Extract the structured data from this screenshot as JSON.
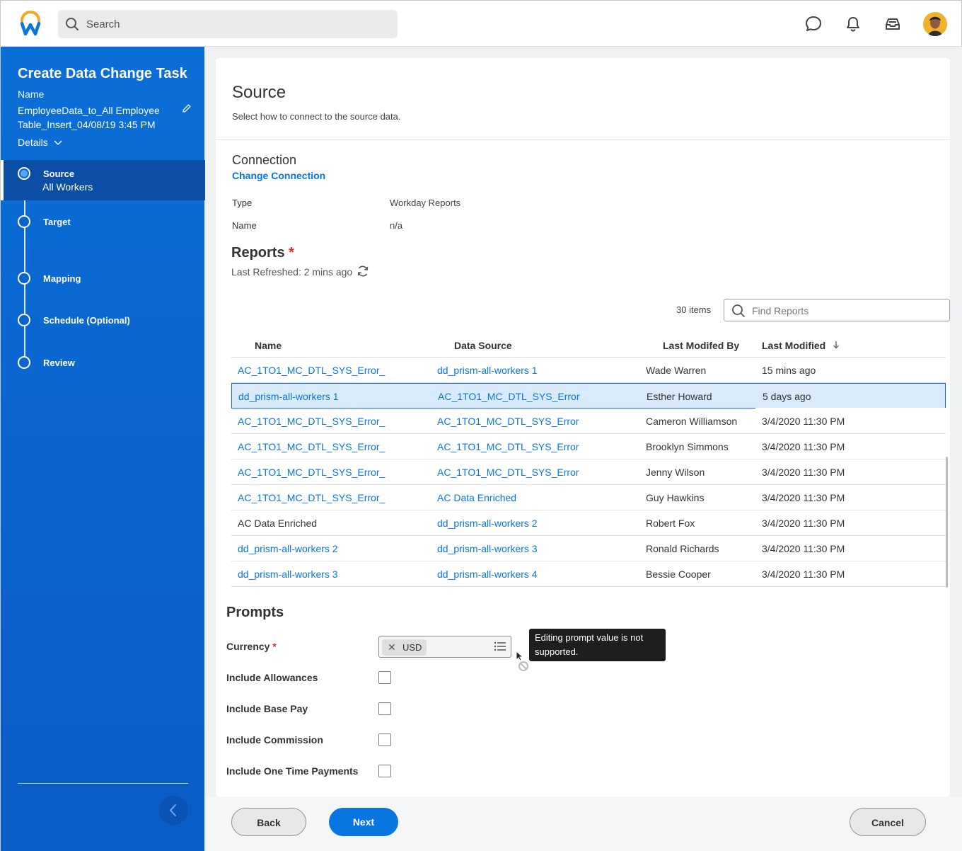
{
  "topbar": {
    "search_placeholder": "Search",
    "icons": [
      "chat-icon",
      "bell-icon",
      "inbox-icon"
    ]
  },
  "sidebar": {
    "title": "Create Data Change Task",
    "name_label": "Name",
    "name_value": "EmployeeData_to_All Employee Table_Insert_04/08/19 3:45 PM",
    "details_label": "Details",
    "steps": [
      {
        "label": "Source",
        "sub": "All Workers",
        "active": true
      },
      {
        "label": "Target",
        "sub": ""
      },
      {
        "label": "Mapping",
        "sub": ""
      },
      {
        "label": "Schedule (Optional)",
        "sub": ""
      },
      {
        "label": "Review",
        "sub": ""
      }
    ]
  },
  "source": {
    "title": "Source",
    "description": "Select how to connect to the source data."
  },
  "connection": {
    "title": "Connection",
    "change_link": "Change Connection",
    "type_label": "Type",
    "type_value": "Workday Reports",
    "name_label": "Name",
    "name_value": "n/a"
  },
  "reports": {
    "title": "Reports",
    "required_mark": "*",
    "last_refreshed": "Last Refreshed: 2 mins ago",
    "items_count": "30 items",
    "find_placeholder": "Find Reports",
    "columns": [
      "Name",
      "Data Source",
      "Last Modifed By",
      "Last Modified"
    ],
    "rows": [
      {
        "name": "AC_1TO1_MC_DTL_SYS_Error_",
        "name_link": true,
        "source": "dd_prism-all-workers 1",
        "source_link": true,
        "by": "Wade Warren",
        "modified": "15 mins ago"
      },
      {
        "name": "dd_prism-all-workers 1",
        "name_link": true,
        "source": "AC_1TO1_MC_DTL_SYS_Error",
        "source_link": true,
        "by": "Esther Howard",
        "modified": "5 days ago",
        "selected": true
      },
      {
        "name": "AC_1TO1_MC_DTL_SYS_Error_",
        "name_link": true,
        "source": "AC_1TO1_MC_DTL_SYS_Error",
        "source_link": true,
        "by": "Cameron Williamson",
        "modified": "3/4/2020 11:30 PM"
      },
      {
        "name": "AC_1TO1_MC_DTL_SYS_Error_",
        "name_link": true,
        "source": "AC_1TO1_MC_DTL_SYS_Error",
        "source_link": true,
        "by": "Brooklyn Simmons",
        "modified": "3/4/2020 11:30 PM"
      },
      {
        "name": "AC_1TO1_MC_DTL_SYS_Error_",
        "name_link": true,
        "source": "AC_1TO1_MC_DTL_SYS_Error",
        "source_link": true,
        "by": "Jenny Wilson",
        "modified": "3/4/2020 11:30 PM"
      },
      {
        "name": "AC_1TO1_MC_DTL_SYS_Error_",
        "name_link": true,
        "source": "AC Data Enriched",
        "source_link": true,
        "by": "Guy Hawkins",
        "modified": "3/4/2020 11:30 PM"
      },
      {
        "name": "AC Data Enriched",
        "name_link": false,
        "source": "dd_prism-all-workers 2",
        "source_link": true,
        "by": "Robert Fox",
        "modified": "3/4/2020 11:30 PM"
      },
      {
        "name": "dd_prism-all-workers 2",
        "name_link": true,
        "source": "dd_prism-all-workers 3",
        "source_link": true,
        "by": "Ronald Richards",
        "modified": "3/4/2020 11:30 PM"
      },
      {
        "name": "dd_prism-all-workers 3",
        "name_link": true,
        "source": "dd_prism-all-workers 4",
        "source_link": true,
        "by": "Bessie Cooper",
        "modified": "3/4/2020 11:30 PM"
      }
    ]
  },
  "prompts": {
    "title": "Prompts",
    "currency_label": "Currency",
    "currency_value": "USD",
    "checkboxes": [
      "Include Allowances",
      "Include Base Pay",
      "Include Commission",
      "Include One Time Payments"
    ],
    "tooltip": "Editing prompt value is not supported."
  },
  "footer": {
    "back": "Back",
    "next": "Next",
    "cancel": "Cancel"
  },
  "colors": {
    "primary": "#0875e1",
    "sidebar": "#0a66d1",
    "required": "#de2e21",
    "selected_row": "#d9eafb"
  }
}
